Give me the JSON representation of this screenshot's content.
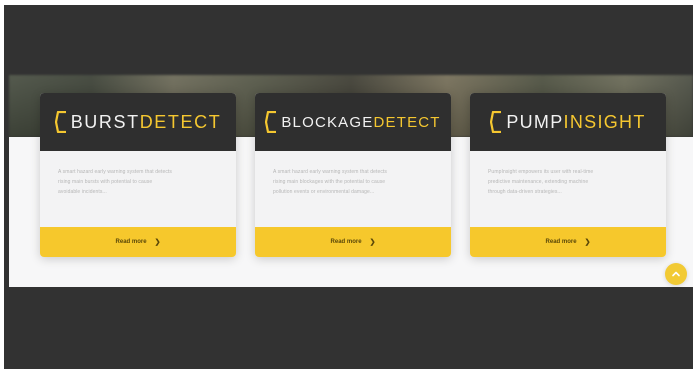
{
  "cards": [
    {
      "logo_part_1": "BURST",
      "logo_part_2": "DETECT",
      "description_lines": [
        "A smart hazard early warning system that detects",
        "rising main bursts with potential to cause",
        "avoidable incidents..."
      ],
      "button_label": "Read more"
    },
    {
      "logo_part_1": "BLOCKAGE",
      "logo_part_2": "DETECT",
      "description_lines": [
        "A smart hazard early warning system that detects",
        "rising main blockages with the potential to cause",
        "pollution events or environmental damage..."
      ],
      "button_label": "Read more"
    },
    {
      "logo_part_1": "PUMP",
      "logo_part_2": "INSIGHT",
      "description_lines": [
        "PumpInsight empowers its user with real-time",
        "predictive maintenance, extending machine",
        "through data-driven strategies..."
      ],
      "button_label": "Read more"
    }
  ],
  "icons": {
    "logo_mark": "hexagon-bracket-icon",
    "read_more_arrow": "chevron-right-icon",
    "scroll_top": "chevron-up-icon"
  },
  "colors": {
    "accent": "#f6c82c",
    "card_header": "#2f2f2f",
    "frame": "#323232"
  }
}
